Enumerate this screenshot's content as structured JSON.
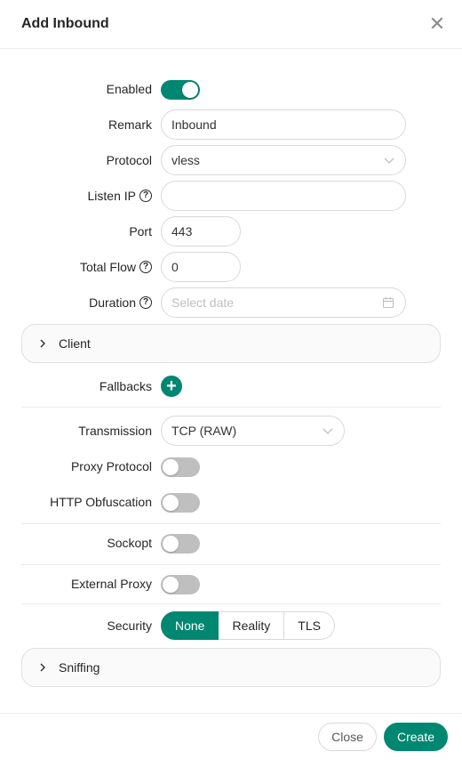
{
  "dialog": {
    "title": "Add Inbound",
    "close_glyph": "✕"
  },
  "fields": {
    "enabled": {
      "label": "Enabled",
      "on": true
    },
    "remark": {
      "label": "Remark",
      "value": "Inbound"
    },
    "protocol": {
      "label": "Protocol",
      "value": "vless"
    },
    "listen_ip": {
      "label": "Listen IP",
      "value": ""
    },
    "port": {
      "label": "Port",
      "value": "443"
    },
    "total_flow": {
      "label": "Total Flow",
      "value": "0"
    },
    "duration": {
      "label": "Duration",
      "placeholder": "Select date"
    },
    "fallbacks": {
      "label": "Fallbacks",
      "add_glyph": "+"
    },
    "transmission": {
      "label": "Transmission",
      "value": "TCP (RAW)"
    },
    "proxy_protocol": {
      "label": "Proxy Protocol",
      "on": false
    },
    "http_obfuscation": {
      "label": "HTTP Obfuscation",
      "on": false
    },
    "sockopt": {
      "label": "Sockopt",
      "on": false
    },
    "external_proxy": {
      "label": "External Proxy",
      "on": false
    },
    "security": {
      "label": "Security",
      "options": [
        "None",
        "Reality",
        "TLS"
      ],
      "selected": "None"
    }
  },
  "sections": {
    "client": "Client",
    "sniffing": "Sniffing"
  },
  "help_glyph": "?",
  "footer": {
    "close_label": "Close",
    "create_label": "Create"
  },
  "colors": {
    "accent": "#008771",
    "switch_off": "#bfbfbf"
  },
  "icons": [
    "close-icon",
    "help-icon",
    "chevron-down-icon",
    "calendar-icon",
    "chevron-right-icon",
    "plus-icon"
  ]
}
